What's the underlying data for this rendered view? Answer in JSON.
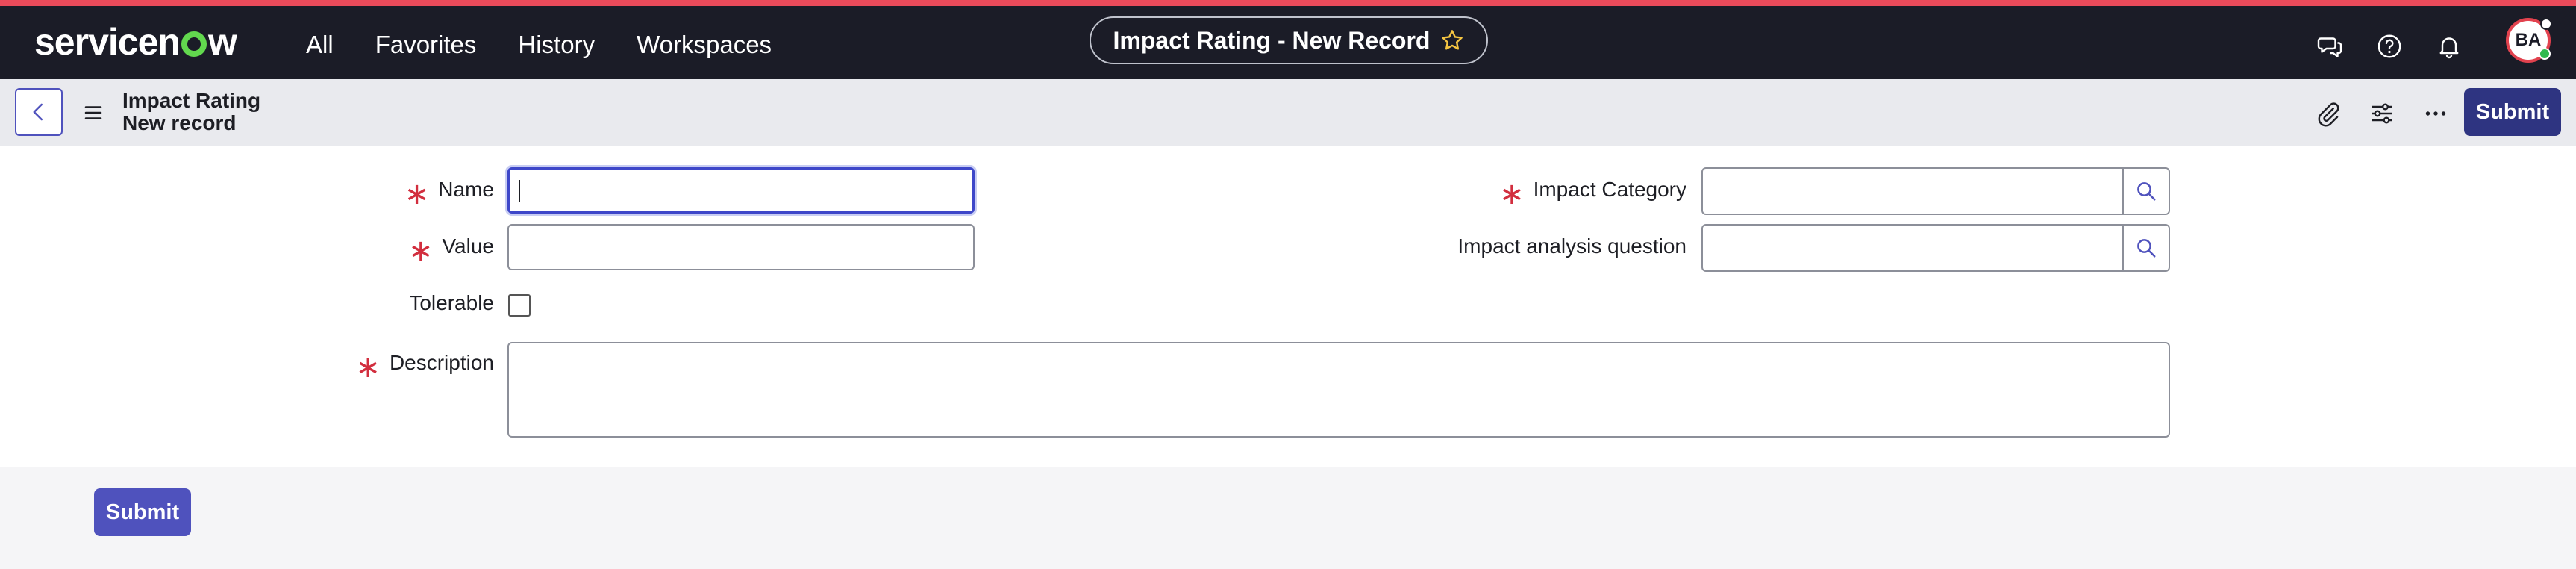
{
  "app": {
    "logo_text_a": "servicen",
    "logo_text_b": "w"
  },
  "nav": {
    "items": [
      "All",
      "Favorites",
      "History",
      "Workspaces"
    ]
  },
  "header": {
    "title": "Impact Rating - New Record"
  },
  "user": {
    "initials": "BA"
  },
  "record": {
    "table": "Impact Rating",
    "state": "New record"
  },
  "toolbar": {
    "submit_label": "Submit"
  },
  "form": {
    "name_label": "Name",
    "name_value": "",
    "value_label": "Value",
    "value_value": "",
    "tolerable_label": "Tolerable",
    "tolerable_checked": false,
    "description_label": "Description",
    "description_value": "",
    "impact_category_label": "Impact Category",
    "impact_category_value": "",
    "impact_question_label": "Impact analysis question",
    "impact_question_value": ""
  },
  "footer": {
    "submit_label": "Submit"
  },
  "colors": {
    "accent": "#4f52bd",
    "required": "#d22e3e",
    "brand_green": "#62d84e",
    "topbar": "#1b1c27"
  }
}
